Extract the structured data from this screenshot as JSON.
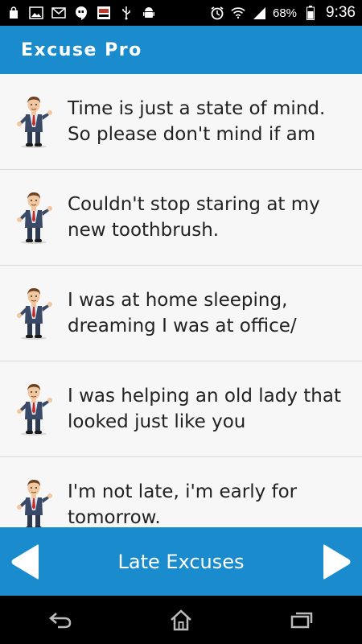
{
  "status_bar": {
    "battery_percent": "68%",
    "time": "9:36",
    "icons": [
      "bag-icon",
      "image-icon",
      "gmail-icon",
      "hangouts-icon",
      "sony-tv-icon",
      "usb-icon",
      "android-icon",
      "alarm-icon",
      "wifi-icon",
      "signal-icon",
      "battery-icon"
    ]
  },
  "app_bar": {
    "title": "Excuse Pro"
  },
  "excuses": [
    {
      "text": "Time is just a state of mind. So please don't mind if am"
    },
    {
      "text": "Couldn't stop staring at my new toothbrush."
    },
    {
      "text": "I was at home sleeping, dreaming I was at office/"
    },
    {
      "text": "I was helping an old lady that looked just like you"
    },
    {
      "text": "I'm not late, i'm early for tomorrow."
    }
  ],
  "bottom_bar": {
    "category": "Late Excuses"
  },
  "colors": {
    "accent": "#1a8ccd",
    "background": "#f7f7f7",
    "text": "#222222"
  }
}
